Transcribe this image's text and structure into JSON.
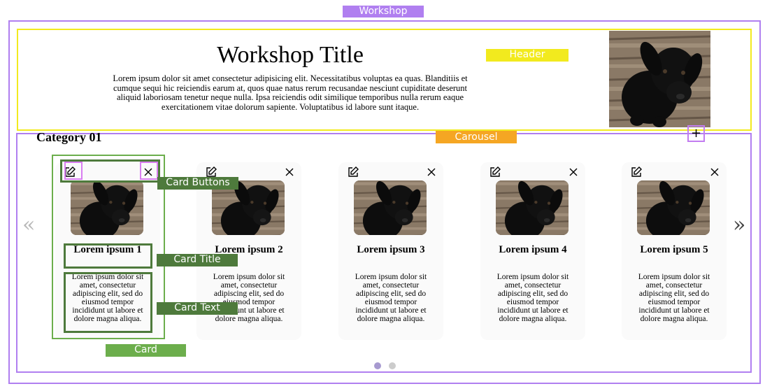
{
  "annotations": {
    "workshop": "Workshop",
    "header": "Header",
    "carousel": "Carousel",
    "card_buttons": "Card Buttons",
    "card_title": "Card Title",
    "card_text": "Card Text",
    "card": "Card"
  },
  "header": {
    "title": "Workshop Title",
    "description": "Lorem ipsum dolor sit amet consectetur adipisicing elit. Necessitatibus voluptas ea quas. Blanditiis et cumque sequi hic reiciendis earum at, quos quae natus rerum recusandae nesciunt cupiditate deserunt aliquid laboriosam tenetur neque nulla. Ipsa reiciendis odit similique temporibus nulla rerum eaque exercitationem vitae dolorum sapiente. Voluptatibus id labore sunt itaque.",
    "add_button": "+"
  },
  "carousel": {
    "category": "Category 01",
    "prev": "«",
    "next": "»",
    "cards": [
      {
        "title": "Lorem ipsum 1",
        "text": "Lorem ipsum dolor sit amet, consectetur adipiscing elit, sed do eiusmod tempor incididunt ut labore et dolore magna aliqua."
      },
      {
        "title": "Lorem ipsum 2",
        "text": "Lorem ipsum dolor sit amet, consectetur adipiscing elit, sed do eiusmod tempor incididunt ut labore et dolore magna aliqua."
      },
      {
        "title": "Lorem ipsum 3",
        "text": "Lorem ipsum dolor sit amet, consectetur adipiscing elit, sed do eiusmod tempor incididunt ut labore et dolore magna aliqua."
      },
      {
        "title": "Lorem ipsum 4",
        "text": "Lorem ipsum dolor sit amet, consectetur adipiscing elit, sed do eiusmod tempor incididunt ut labore et dolore magna aliqua."
      },
      {
        "title": "Lorem ipsum 5",
        "text": "Lorem ipsum dolor sit amet, consectetur adipiscing elit, sed do eiusmod tempor incididunt ut labore et dolore magna aliqua."
      }
    ],
    "active_page": 1,
    "page_count": 2
  },
  "colors": {
    "workshop_outline": "#b07ff0",
    "header_outline": "#f2ea1e",
    "carousel_tag": "#f5a623",
    "card_outline": "#6cae4c",
    "card_part_outline": "#4e7a3c"
  },
  "icons": {
    "edit": "edit-icon",
    "close": "close-icon",
    "add": "plus-icon"
  }
}
